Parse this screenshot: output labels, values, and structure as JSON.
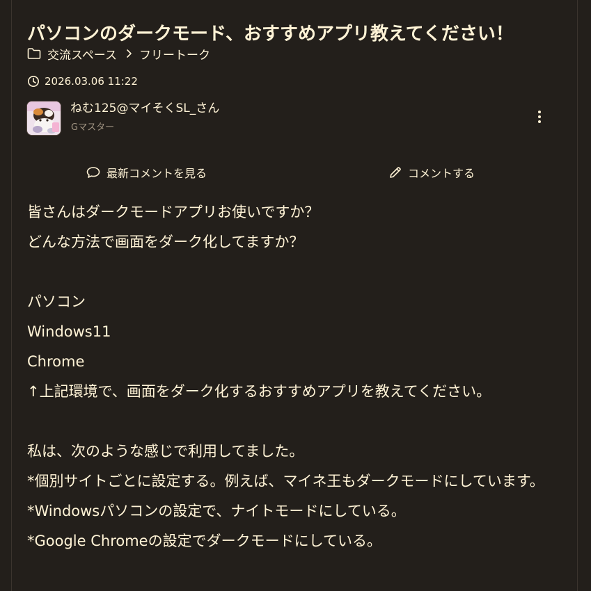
{
  "post": {
    "title": "パソコンのダークモード、おすすめアプリ教えてください！",
    "breadcrumb": {
      "category": "交流スペース",
      "subcategory": "フリートーク"
    },
    "datetime": "2026.03.06 11:22",
    "author": {
      "name": "ねむ125@マイそくSL_さん",
      "rank": "Gマスター"
    },
    "actions": {
      "latest_comments": "最新コメントを見る",
      "write_comment": "コメントする"
    },
    "body": {
      "line1": "皆さんはダークモードアプリお使いですか？",
      "line2": "どんな方法で画面をダーク化してますか？",
      "line3": "パソコン",
      "line4": "Windows11",
      "line5": "Chrome",
      "line6": "↑上記環境で、画面をダーク化するおすすめアプリを教えてください。",
      "line7": "私は、次のような感じで利用してました。",
      "line8": "*個別サイトごとに設定する。例えば、マイネ王もダークモードにしています。",
      "line9": "*Windowsパソコンの設定で、ナイトモードにしている。",
      "line10": "*Google Chromeの設定でダークモードにしている。"
    }
  },
  "icons": {
    "breadcrumb": "folder-icon",
    "separator": "chevron-right-icon",
    "date": "clock-icon",
    "more": "more-vertical-icon",
    "latest": "speech-bubble-icon",
    "comment": "pencil-icon"
  },
  "colors": {
    "background": "#231f1b",
    "text": "#fff3d6",
    "muted": "#a39684",
    "border": "#3b342e"
  }
}
